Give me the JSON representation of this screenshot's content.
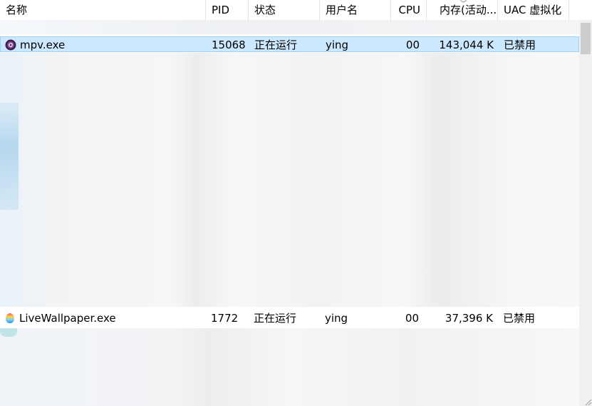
{
  "columns": [
    {
      "id": "name",
      "label": "名称"
    },
    {
      "id": "pid",
      "label": "PID"
    },
    {
      "id": "status",
      "label": "状态"
    },
    {
      "id": "user",
      "label": "用户名"
    },
    {
      "id": "cpu",
      "label": "CPU"
    },
    {
      "id": "memory",
      "label": "内存(活动..."
    },
    {
      "id": "uac",
      "label": "UAC 虚拟化"
    }
  ],
  "sort": {
    "column": "memory",
    "direction": "descending"
  },
  "rows": [
    {
      "name": "mpv.exe",
      "pid": "15068",
      "status": "正在运行",
      "user": "ying",
      "cpu": "00",
      "memory": "143,044 K",
      "uac": "已禁用",
      "icon": "mpv-icon",
      "selected": true
    },
    {
      "name": "LiveWallpaper.exe",
      "pid": "1772",
      "status": "正在运行",
      "user": "ying",
      "cpu": "00",
      "memory": "37,396 K",
      "uac": "已禁用",
      "icon": "livewallpaper-icon",
      "selected": false
    }
  ],
  "colors": {
    "selection_bg": "#cce8ff",
    "selection_border": "#99d1ff"
  }
}
